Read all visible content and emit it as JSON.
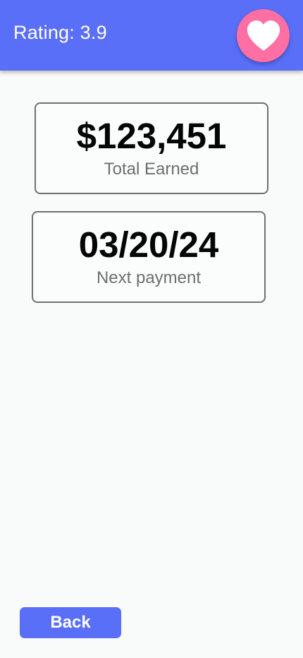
{
  "header": {
    "rating_text": "Rating: 3.9",
    "favorite_icon": "heart-icon"
  },
  "cards": {
    "earned": {
      "value": "$123,451",
      "label": "Total Earned"
    },
    "payment": {
      "value": "03/20/24",
      "label": "Next payment"
    }
  },
  "footer": {
    "back_label": "Back"
  },
  "colors": {
    "accent": "#5a6ff8",
    "favorite": "#ff6fa3",
    "background": "#f9fbfa"
  }
}
